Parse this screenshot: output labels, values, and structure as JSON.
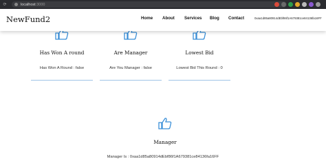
{
  "browser": {
    "url_host": "localhost",
    "url_port": ":3000"
  },
  "nav": {
    "brand": "NewFund2",
    "links": [
      "Home",
      "About",
      "Services",
      "Blog",
      "Contact"
    ],
    "account": "0xaa1d85a80914dEbf86f1A679381ce84136fa16FF"
  },
  "cards": [
    {
      "title": "Has Won A round",
      "value": "Has Won A Round : false",
      "icon": "thumbs-up-icon"
    },
    {
      "title": "Are Manager",
      "value": "Are You Manager : false",
      "icon": "thumbs-up-icon"
    },
    {
      "title": "Lowest Bid",
      "value": "Lowest Bid This Round : 0",
      "icon": "thumbs-up-icon"
    }
  ],
  "manager": {
    "title": "Manager",
    "value": "Manager Is : 0xaa1d85a80914dEbf86f1A679381ce84136fa16FF",
    "icon": "thumbs-up-icon"
  },
  "colors": {
    "accent_blue": "#3a8fd8",
    "rule_blue": "#9fc3e6",
    "chrome_bg": "#2b2c30"
  }
}
